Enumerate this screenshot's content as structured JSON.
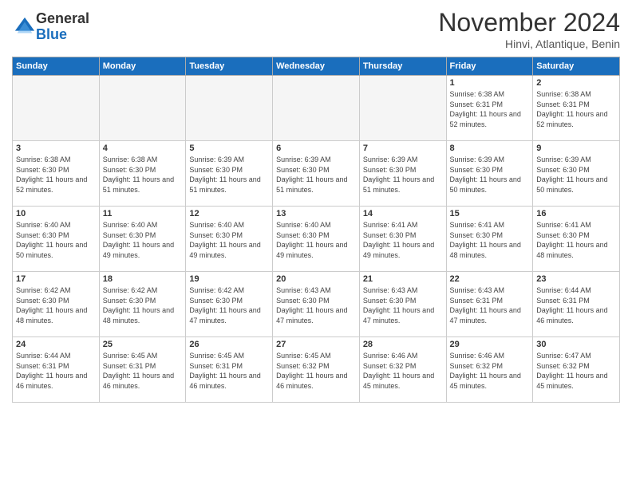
{
  "logo": {
    "general": "General",
    "blue": "Blue"
  },
  "header": {
    "title": "November 2024",
    "location": "Hinvi, Atlantique, Benin"
  },
  "weekdays": [
    "Sunday",
    "Monday",
    "Tuesday",
    "Wednesday",
    "Thursday",
    "Friday",
    "Saturday"
  ],
  "weeks": [
    [
      {
        "day": "",
        "info": ""
      },
      {
        "day": "",
        "info": ""
      },
      {
        "day": "",
        "info": ""
      },
      {
        "day": "",
        "info": ""
      },
      {
        "day": "",
        "info": ""
      },
      {
        "day": "1",
        "info": "Sunrise: 6:38 AM\nSunset: 6:31 PM\nDaylight: 11 hours and 52 minutes."
      },
      {
        "day": "2",
        "info": "Sunrise: 6:38 AM\nSunset: 6:31 PM\nDaylight: 11 hours and 52 minutes."
      }
    ],
    [
      {
        "day": "3",
        "info": "Sunrise: 6:38 AM\nSunset: 6:30 PM\nDaylight: 11 hours and 52 minutes."
      },
      {
        "day": "4",
        "info": "Sunrise: 6:38 AM\nSunset: 6:30 PM\nDaylight: 11 hours and 51 minutes."
      },
      {
        "day": "5",
        "info": "Sunrise: 6:39 AM\nSunset: 6:30 PM\nDaylight: 11 hours and 51 minutes."
      },
      {
        "day": "6",
        "info": "Sunrise: 6:39 AM\nSunset: 6:30 PM\nDaylight: 11 hours and 51 minutes."
      },
      {
        "day": "7",
        "info": "Sunrise: 6:39 AM\nSunset: 6:30 PM\nDaylight: 11 hours and 51 minutes."
      },
      {
        "day": "8",
        "info": "Sunrise: 6:39 AM\nSunset: 6:30 PM\nDaylight: 11 hours and 50 minutes."
      },
      {
        "day": "9",
        "info": "Sunrise: 6:39 AM\nSunset: 6:30 PM\nDaylight: 11 hours and 50 minutes."
      }
    ],
    [
      {
        "day": "10",
        "info": "Sunrise: 6:40 AM\nSunset: 6:30 PM\nDaylight: 11 hours and 50 minutes."
      },
      {
        "day": "11",
        "info": "Sunrise: 6:40 AM\nSunset: 6:30 PM\nDaylight: 11 hours and 49 minutes."
      },
      {
        "day": "12",
        "info": "Sunrise: 6:40 AM\nSunset: 6:30 PM\nDaylight: 11 hours and 49 minutes."
      },
      {
        "day": "13",
        "info": "Sunrise: 6:40 AM\nSunset: 6:30 PM\nDaylight: 11 hours and 49 minutes."
      },
      {
        "day": "14",
        "info": "Sunrise: 6:41 AM\nSunset: 6:30 PM\nDaylight: 11 hours and 49 minutes."
      },
      {
        "day": "15",
        "info": "Sunrise: 6:41 AM\nSunset: 6:30 PM\nDaylight: 11 hours and 48 minutes."
      },
      {
        "day": "16",
        "info": "Sunrise: 6:41 AM\nSunset: 6:30 PM\nDaylight: 11 hours and 48 minutes."
      }
    ],
    [
      {
        "day": "17",
        "info": "Sunrise: 6:42 AM\nSunset: 6:30 PM\nDaylight: 11 hours and 48 minutes."
      },
      {
        "day": "18",
        "info": "Sunrise: 6:42 AM\nSunset: 6:30 PM\nDaylight: 11 hours and 48 minutes."
      },
      {
        "day": "19",
        "info": "Sunrise: 6:42 AM\nSunset: 6:30 PM\nDaylight: 11 hours and 47 minutes."
      },
      {
        "day": "20",
        "info": "Sunrise: 6:43 AM\nSunset: 6:30 PM\nDaylight: 11 hours and 47 minutes."
      },
      {
        "day": "21",
        "info": "Sunrise: 6:43 AM\nSunset: 6:30 PM\nDaylight: 11 hours and 47 minutes."
      },
      {
        "day": "22",
        "info": "Sunrise: 6:43 AM\nSunset: 6:31 PM\nDaylight: 11 hours and 47 minutes."
      },
      {
        "day": "23",
        "info": "Sunrise: 6:44 AM\nSunset: 6:31 PM\nDaylight: 11 hours and 46 minutes."
      }
    ],
    [
      {
        "day": "24",
        "info": "Sunrise: 6:44 AM\nSunset: 6:31 PM\nDaylight: 11 hours and 46 minutes."
      },
      {
        "day": "25",
        "info": "Sunrise: 6:45 AM\nSunset: 6:31 PM\nDaylight: 11 hours and 46 minutes."
      },
      {
        "day": "26",
        "info": "Sunrise: 6:45 AM\nSunset: 6:31 PM\nDaylight: 11 hours and 46 minutes."
      },
      {
        "day": "27",
        "info": "Sunrise: 6:45 AM\nSunset: 6:32 PM\nDaylight: 11 hours and 46 minutes."
      },
      {
        "day": "28",
        "info": "Sunrise: 6:46 AM\nSunset: 6:32 PM\nDaylight: 11 hours and 45 minutes."
      },
      {
        "day": "29",
        "info": "Sunrise: 6:46 AM\nSunset: 6:32 PM\nDaylight: 11 hours and 45 minutes."
      },
      {
        "day": "30",
        "info": "Sunrise: 6:47 AM\nSunset: 6:32 PM\nDaylight: 11 hours and 45 minutes."
      }
    ]
  ]
}
